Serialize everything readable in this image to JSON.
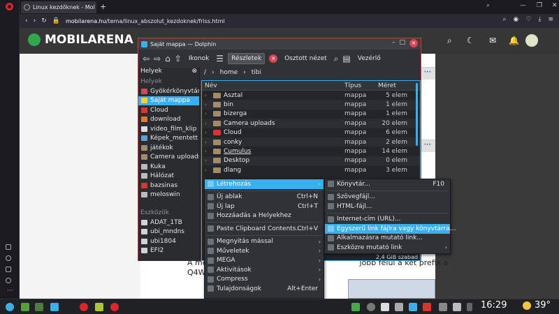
{
  "browser": {
    "tab_title": "Linux kezdőknek - Mol",
    "url_host": "mobilarena.hu",
    "url_path": "/tema/linux_abszolut_kezdoknek/friss.html"
  },
  "site": {
    "logo": "MOBILARENA",
    "text_line1": "A me",
    "text_line1b": "jobb felül a két prefix a",
    "text_line2": "Q4W"
  },
  "dolphin": {
    "title": "Saját mappa — Dolphin",
    "toolbar": {
      "icons_label": "Ikonok",
      "details_label": "Részletek",
      "split_label": "Osztott nézet",
      "control_label": "Vezérlő"
    },
    "places_header": "Helyek",
    "places_section": "Helyek",
    "places": [
      {
        "label": "Gyökérkönyvtár",
        "color": "#da4453"
      },
      {
        "label": "Saját mappa",
        "color": "#f6d32d"
      },
      {
        "label": "Cloud",
        "color": "#d6362f"
      },
      {
        "label": "download",
        "color": "#e07b2a"
      },
      {
        "label": "video_film_klip",
        "color": "#dddddd"
      },
      {
        "label": "Képek_mentett",
        "color": "#5aa0d6"
      },
      {
        "label": "játékok",
        "color": "#a28a6b"
      },
      {
        "label": "Camera uploads",
        "color": "#a28a6b"
      },
      {
        "label": "Kuka",
        "color": "#bbbbbb"
      },
      {
        "label": "Hálózat",
        "color": "#bbbbbb"
      },
      {
        "label": "bazsinas",
        "color": "#d6362f"
      },
      {
        "label": "meloswin",
        "color": "#bbbbbb"
      }
    ],
    "devices_section": "Eszközök",
    "devices": [
      "ADAT_1TB",
      "ubi_mndns",
      "ubi1804",
      "EFI2"
    ],
    "breadcrumb": [
      "/",
      "home",
      "tibi"
    ],
    "columns": [
      "Név",
      "Típus",
      "Méret"
    ],
    "files": [
      {
        "name": "Asztal",
        "type": "mappa",
        "size": "5 elem",
        "red": false
      },
      {
        "name": "bin",
        "type": "mappa",
        "size": "1 elem",
        "red": false
      },
      {
        "name": "bizerga",
        "type": "mappa",
        "size": "1 elem",
        "red": false
      },
      {
        "name": "Camera uploads",
        "type": "mappa",
        "size": "20 elem",
        "red": false
      },
      {
        "name": "Cloud",
        "type": "mappa",
        "size": "6 elem",
        "red": true
      },
      {
        "name": "conky",
        "type": "mappa",
        "size": "2 elem",
        "red": false
      },
      {
        "name": "Cumulus",
        "type": "mappa",
        "size": "14 elem",
        "red": false
      },
      {
        "name": "Desktop",
        "type": "mappa",
        "size": "0 elem",
        "red": false
      },
      {
        "name": "dlang",
        "type": "mappa",
        "size": "3 elem",
        "red": false
      }
    ],
    "free_space": "2,4 GiB szabad"
  },
  "context_menu": {
    "items": [
      {
        "label": "Létrehozás",
        "shortcut": "",
        "submenu": true,
        "hl": true
      },
      {
        "sep": true
      },
      {
        "label": "Új ablak",
        "shortcut": "Ctrl+N"
      },
      {
        "label": "Új lap",
        "shortcut": "Ctrl+T"
      },
      {
        "label": "Hozzáadás a Helyekhez",
        "shortcut": ""
      },
      {
        "sep": true
      },
      {
        "label": "Paste Clipboard Contents...",
        "shortcut": "Ctrl+V"
      },
      {
        "sep": true
      },
      {
        "label": "Megnyitás mással",
        "shortcut": "",
        "submenu": true
      },
      {
        "label": "Műveletek",
        "shortcut": "",
        "submenu": true
      },
      {
        "label": "MEGA",
        "shortcut": "",
        "submenu": true
      },
      {
        "label": "Aktivitások",
        "shortcut": "",
        "submenu": true
      },
      {
        "label": "Compress",
        "shortcut": "",
        "submenu": true
      },
      {
        "label": "Tulajdonságok",
        "shortcut": "Alt+Enter"
      }
    ]
  },
  "submenu": {
    "items": [
      {
        "label": "Könyvtár...",
        "shortcut": "F10"
      },
      {
        "sep": true
      },
      {
        "label": "Szövegfájl...",
        "shortcut": ""
      },
      {
        "label": "HTML-fájl...",
        "shortcut": ""
      },
      {
        "sep": true
      },
      {
        "label": "Internet-cím (URL)...",
        "shortcut": ""
      },
      {
        "label": "Egyszerű link fájlra vagy könyvtárra...",
        "shortcut": "",
        "hl": true
      },
      {
        "label": "Alkalmazásra mutató link...",
        "shortcut": ""
      },
      {
        "label": "Eszközre mutató link",
        "shortcut": "",
        "submenu": true
      }
    ]
  },
  "taskbar": {
    "clock": "16:29",
    "temperature": "39°"
  }
}
